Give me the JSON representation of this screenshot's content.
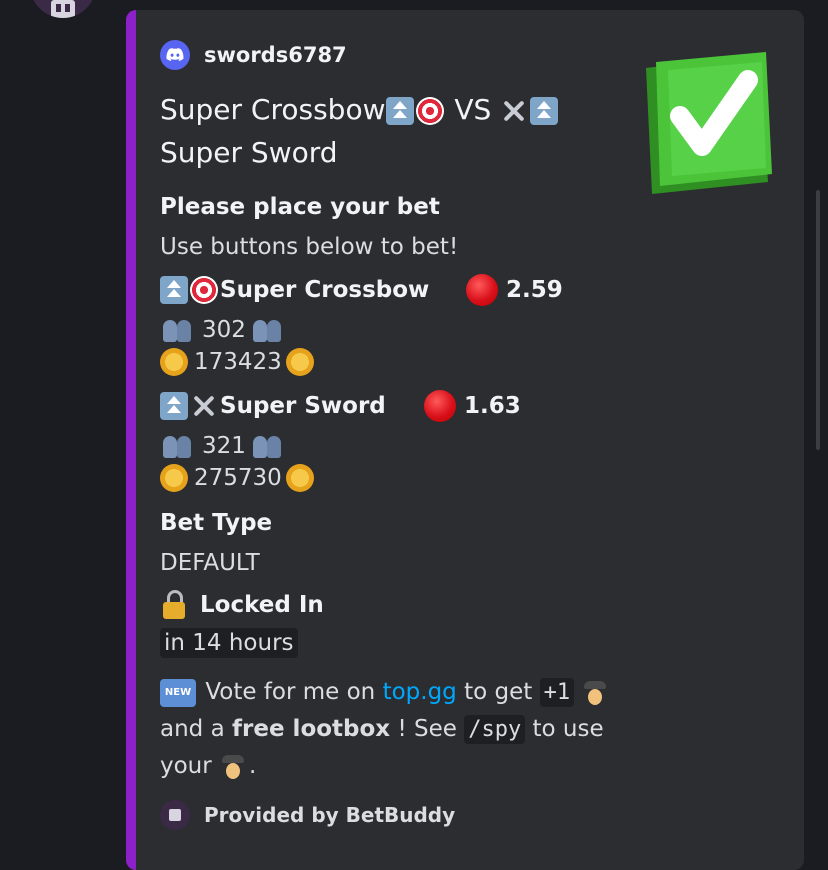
{
  "message": {
    "embed": {
      "author": {
        "name": "swords6787",
        "icon": "discord-icon"
      },
      "title_parts": {
        "a": "Super Crossbow",
        "vs": "VS",
        "b": "Super Sword"
      },
      "thumbnail": {
        "icon": "check-mark-icon",
        "color": "#4bc43a"
      },
      "accent_color": "#8d21c9",
      "fields": {
        "bet_prompt": {
          "name": "Please place your bet",
          "value": "Use buttons below to bet!"
        },
        "side_a": {
          "label": "Super Crossbow",
          "odds": "2.59",
          "players": "302",
          "pool": "173423"
        },
        "side_b": {
          "label": "Super Sword",
          "odds": "1.63",
          "players": "321",
          "pool": "275730"
        },
        "bet_type": {
          "name": "Bet Type",
          "value": "DEFAULT"
        },
        "locked": {
          "name": "Locked In",
          "value": "in 14 hours"
        }
      },
      "promo": {
        "t1": "Vote for me on",
        "link": "top.gg",
        "t2": "to get",
        "code1": "+1",
        "t3": "and a",
        "bold": "free lootbox",
        "t4": "! See",
        "code2": "/spy",
        "t5": "to use",
        "t6": "your",
        "t7": "."
      },
      "footer": {
        "text": "Provided by BetBuddy"
      }
    }
  }
}
